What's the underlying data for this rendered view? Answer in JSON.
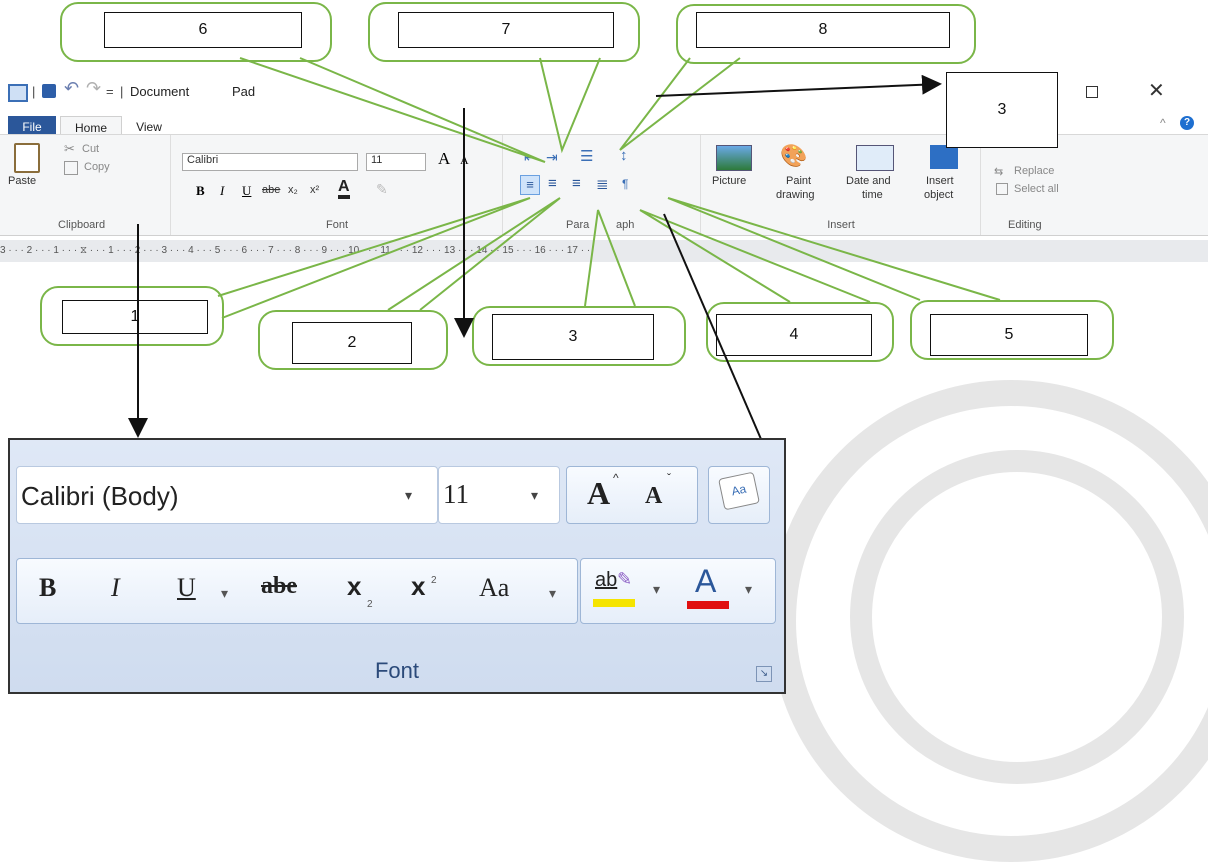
{
  "callout_numbers": {
    "c6": "6",
    "c7": "7",
    "c8": "8",
    "c3top": "3",
    "c1": "1",
    "c2": "2",
    "c3": "3",
    "c4": "4",
    "c5": "5"
  },
  "window": {
    "title_left": "Document",
    "title_right": "Pad",
    "qa_sep": "|",
    "qa_dropdown": "=",
    "tabs": [
      "File",
      "Home",
      "View"
    ]
  },
  "ribbon": {
    "clipboard": {
      "paste": "Paste",
      "cut": "Cut",
      "copy": "Copy",
      "label": "Clipboard"
    },
    "font": {
      "name": "Calibri",
      "size": "11",
      "label": "Font",
      "bold": "B",
      "italic": "I",
      "underline": "U",
      "strike": "abe",
      "sub": "x₂",
      "sup": "x²",
      "grow": "A",
      "shrink": "A"
    },
    "paragraph": {
      "label_left": "Para",
      "label_right": "aph"
    },
    "insert": {
      "picture": "Picture",
      "paint1": "Paint",
      "paint2": "drawing",
      "date1": "Date and",
      "date2": "time",
      "obj1": "Insert",
      "obj2": "object",
      "label": "Insert"
    },
    "editing": {
      "replace": "Replace",
      "select_all": "Select all",
      "label": "Editing"
    }
  },
  "ruler_text": "3 · · · 2 · · · 1 · · · ⧖ · · · 1 · · · 2 · · · 3 · · · 4 · · · 5 · · · 6 · · · 7 · · · 8 · · · 9 · · · 10 · · · 11 · · · 12 · · · 13 · · · 14 · · 15 · · · 16 · · · 17 · ·",
  "font_panel": {
    "font_name": "Calibri (Body)",
    "font_size": "11",
    "grow": "A",
    "shrink": "A",
    "bold": "B",
    "italic": "I",
    "underline": "U",
    "strike": "abe",
    "subscript": "x",
    "superscript": "x",
    "change_case": "Aa",
    "highlight": "ab",
    "font_color": "A",
    "label": "Font",
    "highlight_color": "#f5e400",
    "font_color_bar": "#e01010"
  },
  "colors": {
    "callout_border": "#7ab648",
    "file_tab": "#2b579a"
  }
}
